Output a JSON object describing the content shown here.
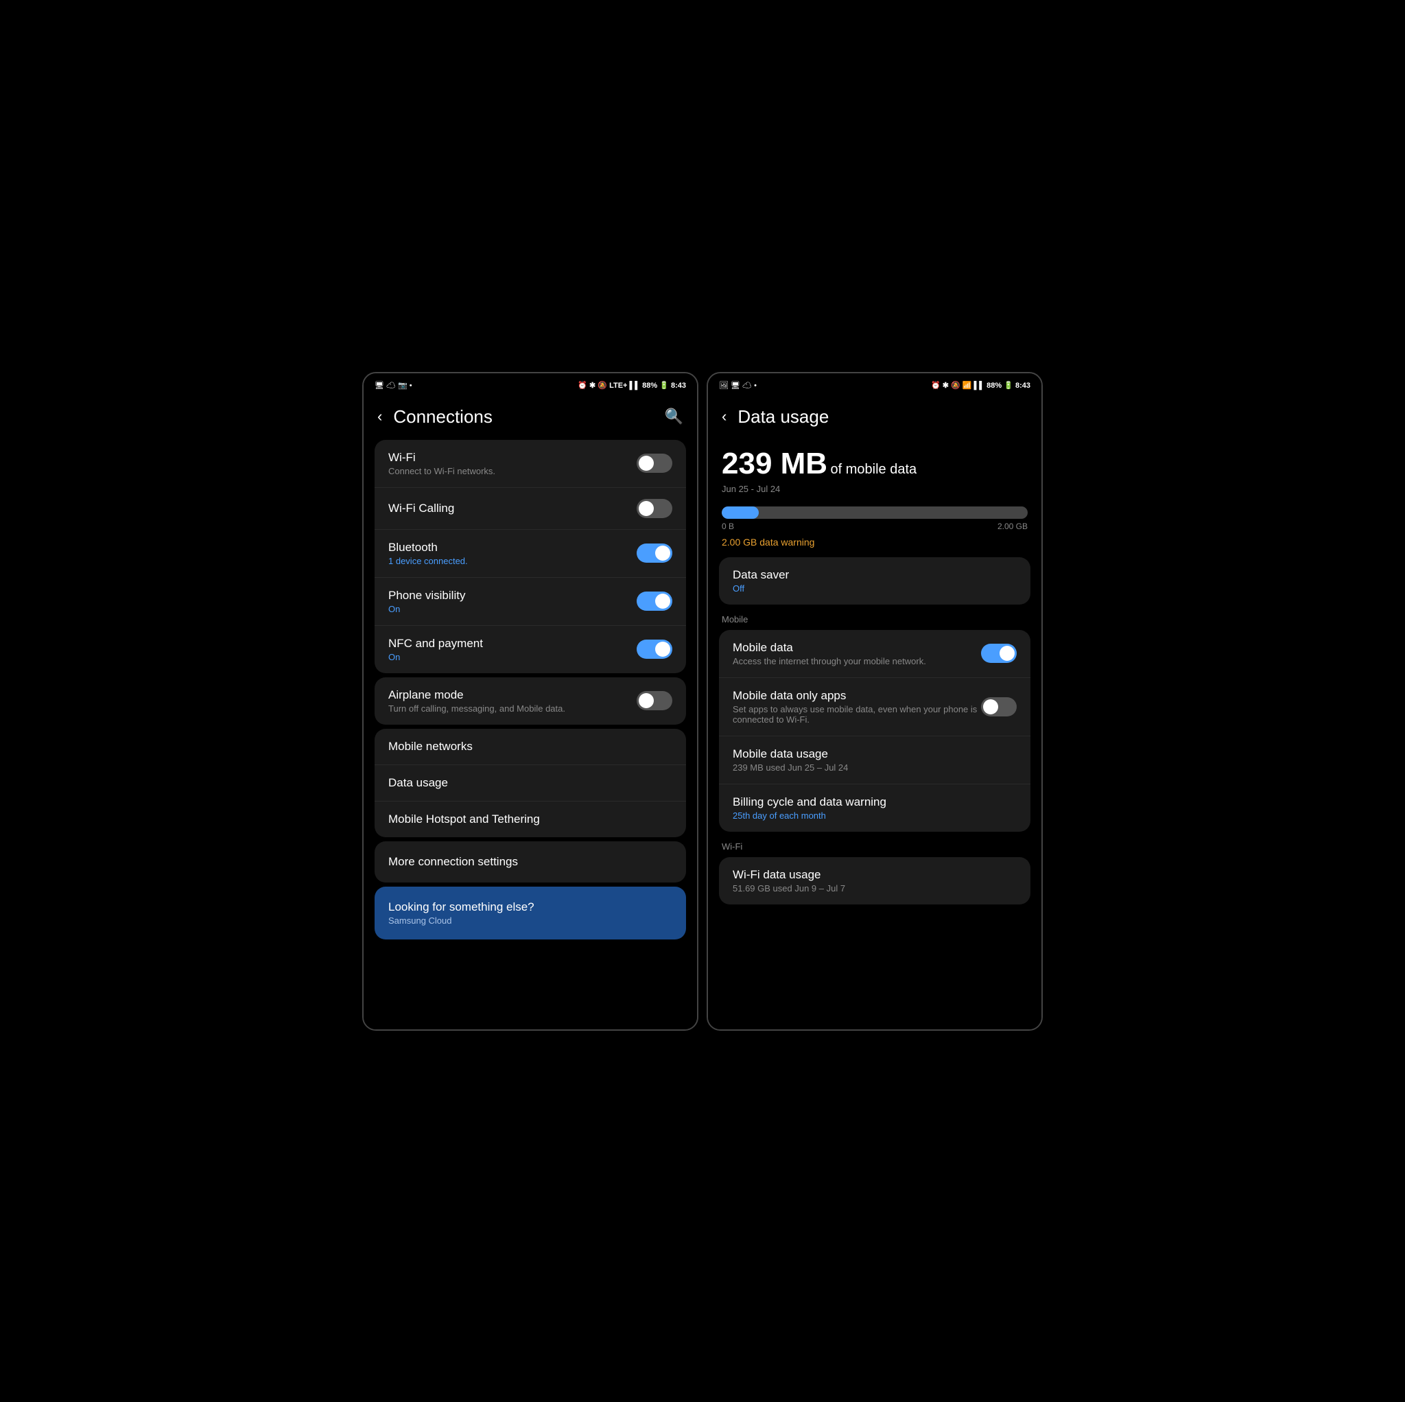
{
  "left_screen": {
    "status_bar": {
      "left": "🖥 ☁ 📷 •",
      "center": "⏰ * 🔕 LTE+",
      "right": "88% 🔋 8:43"
    },
    "header": {
      "title": "Connections",
      "back_label": "‹",
      "search_label": "🔍"
    },
    "settings_group1": [
      {
        "id": "wifi",
        "title": "Wi-Fi",
        "subtitle": "Connect to Wi-Fi networks.",
        "toggle": "off"
      },
      {
        "id": "wifi_calling",
        "title": "Wi-Fi Calling",
        "subtitle": "",
        "toggle": "off"
      },
      {
        "id": "bluetooth",
        "title": "Bluetooth",
        "subtitle": "1 device connected.",
        "subtitle_class": "blue",
        "toggle": "on"
      },
      {
        "id": "phone_visibility",
        "title": "Phone visibility",
        "subtitle": "On",
        "subtitle_class": "on",
        "toggle": "on"
      },
      {
        "id": "nfc",
        "title": "NFC and payment",
        "subtitle": "On",
        "subtitle_class": "on",
        "toggle": "on"
      }
    ],
    "airplane_group": [
      {
        "id": "airplane",
        "title": "Airplane mode",
        "subtitle": "Turn off calling, messaging, and Mobile data.",
        "toggle": "off"
      }
    ],
    "menu_items": [
      {
        "id": "mobile_networks",
        "title": "Mobile networks"
      },
      {
        "id": "data_usage",
        "title": "Data usage"
      },
      {
        "id": "mobile_hotspot",
        "title": "Mobile Hotspot and Tethering"
      }
    ],
    "more_settings": {
      "title": "More connection settings"
    },
    "looking_banner": {
      "title": "Looking for something else?",
      "subtitle": "Samsung Cloud"
    }
  },
  "right_screen": {
    "status_bar": {
      "left": "🖼 🖥 ☁ •",
      "right": "⏰ * 🔕 📶 88% 🔋 8:43"
    },
    "header": {
      "title": "Data usage",
      "back_label": "‹"
    },
    "data_summary": {
      "amount": "239 MB",
      "label": "of mobile data",
      "period": "Jun 25 - Jul 24",
      "progress_percent": 12,
      "range_start": "0 B",
      "range_end": "2.00 GB",
      "warning_text": "2.00 GB data warning"
    },
    "data_saver": {
      "title": "Data saver",
      "subtitle": "Off"
    },
    "mobile_section_label": "Mobile",
    "mobile_items": [
      {
        "id": "mobile_data",
        "title": "Mobile data",
        "subtitle": "Access the internet through your mobile network.",
        "toggle": "on"
      },
      {
        "id": "mobile_data_only",
        "title": "Mobile data only apps",
        "subtitle": "Set apps to always use mobile data, even when your phone is connected to Wi-Fi.",
        "toggle": "off"
      },
      {
        "id": "mobile_data_usage",
        "title": "Mobile data usage",
        "subtitle": "239 MB used Jun 25 – Jul 24"
      },
      {
        "id": "billing_cycle",
        "title": "Billing cycle and data warning",
        "subtitle": "25th day of each month",
        "subtitle_class": "blue"
      }
    ],
    "wifi_section_label": "Wi-Fi",
    "wifi_items": [
      {
        "id": "wifi_data_usage",
        "title": "Wi-Fi data usage",
        "subtitle": "51.69 GB used Jun 9 – Jul 7"
      }
    ]
  }
}
